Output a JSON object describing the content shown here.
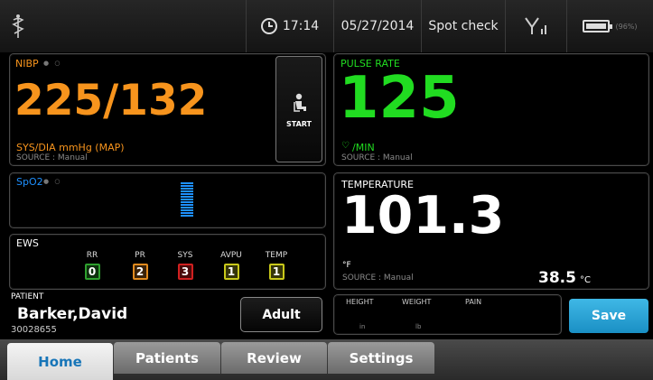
{
  "status": {
    "time": "17:14",
    "date": "05/27/2014",
    "mode": "Spot check",
    "battery_text": "(96%)",
    "icons": [
      "caduceus-icon",
      "clock-icon",
      "signal-icon",
      "battery-icon"
    ]
  },
  "nibp": {
    "label": "NIBP",
    "value": "225/132",
    "units": "SYS/DIA mmHg (MAP)",
    "source": "SOURCE : Manual",
    "start_label": "START"
  },
  "pulse": {
    "label": "PULSE RATE",
    "value": "125",
    "units": "/MIN",
    "source": "SOURCE : Manual"
  },
  "spo2": {
    "label": "SpO2"
  },
  "temperature": {
    "label": "TEMPERATURE",
    "value": "101.3",
    "unit_f": "°F",
    "source": "SOURCE : Manual",
    "celsius": "38.5",
    "unit_c": "°C"
  },
  "ews": {
    "label": "EWS",
    "items": [
      {
        "name": "RR",
        "score": "0",
        "color": "#2ea02e"
      },
      {
        "name": "PR",
        "score": "2",
        "color": "#e08a1e"
      },
      {
        "name": "SYS",
        "score": "3",
        "color": "#d02020"
      },
      {
        "name": "AVPU",
        "score": "1",
        "color": "#c8c81a"
      },
      {
        "name": "TEMP",
        "score": "1",
        "color": "#c8c81a"
      }
    ]
  },
  "patient": {
    "label": "PATIENT",
    "name": "Barker,David",
    "id": "30028655",
    "type_button": "Adult"
  },
  "manual": {
    "height_label": "HEIGHT",
    "height_unit": "in",
    "weight_label": "WEIGHT",
    "weight_unit": "lb",
    "pain_label": "PAIN"
  },
  "save_label": "Save",
  "tabs": [
    "Home",
    "Patients",
    "Review",
    "Settings"
  ],
  "colors": {
    "nibp": "#f7941d",
    "pulse": "#21dc21",
    "spo2": "#1e90ff",
    "save": "#1a8fc4"
  }
}
